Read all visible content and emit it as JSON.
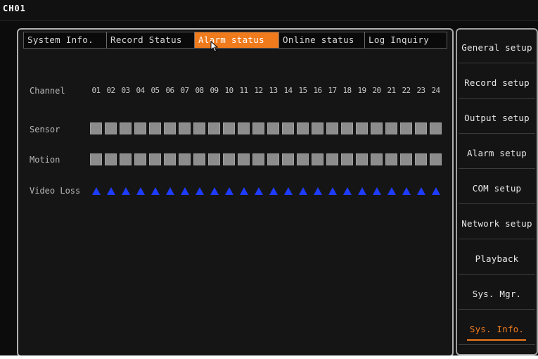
{
  "header": {
    "channel_label": "CH01"
  },
  "tabs": [
    {
      "label": "System Info.",
      "active": false
    },
    {
      "label": "Record Status",
      "active": false
    },
    {
      "label": "Alarm status",
      "active": true
    },
    {
      "label": "Online status",
      "active": false
    },
    {
      "label": "Log Inquiry",
      "active": false
    }
  ],
  "alarm_status": {
    "channel_label": "Channel",
    "sensor_label": "Sensor",
    "motion_label": "Motion",
    "video_loss_label": "Video Loss",
    "channels": [
      "01",
      "02",
      "03",
      "04",
      "05",
      "06",
      "07",
      "08",
      "09",
      "10",
      "11",
      "12",
      "13",
      "14",
      "15",
      "16",
      "17",
      "18",
      "19",
      "20",
      "21",
      "22",
      "23",
      "24"
    ]
  },
  "side_menu": {
    "items": [
      {
        "label": "General setup",
        "active": false
      },
      {
        "label": "Record setup",
        "active": false
      },
      {
        "label": "Output setup",
        "active": false
      },
      {
        "label": "Alarm setup",
        "active": false
      },
      {
        "label": "COM setup",
        "active": false
      },
      {
        "label": "Network setup",
        "active": false
      },
      {
        "label": "Playback",
        "active": false
      },
      {
        "label": "Sys. Mgr.",
        "active": false
      },
      {
        "label": "Sys. Info.",
        "active": true
      }
    ]
  },
  "colors": {
    "accent": "#f07b1c",
    "indicator_gray": "#8c8c8c",
    "video_loss_blue": "#1e3cff"
  }
}
